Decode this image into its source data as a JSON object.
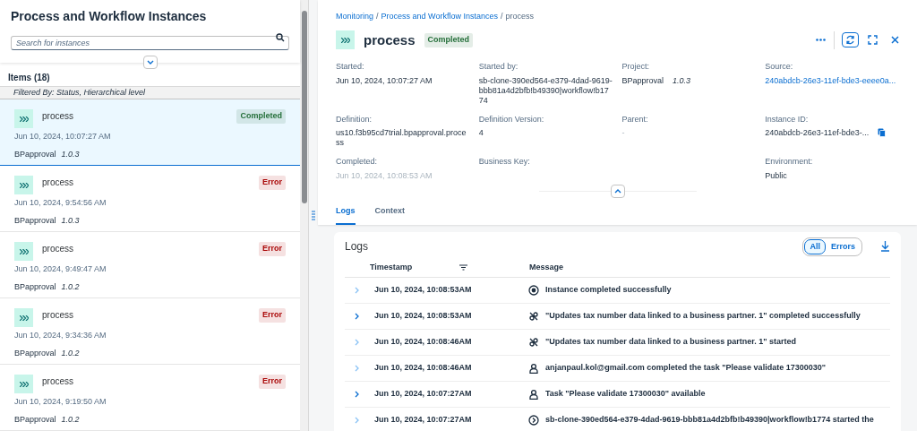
{
  "list_panel": {
    "title": "Process and Workflow Instances",
    "search": {
      "placeholder": "Search for instances"
    },
    "items_header": "Items (18)",
    "filter_info": "Filtered By: Status, Hierarchical level",
    "items": [
      {
        "name": "process",
        "status": "Completed",
        "color": "#256f3a",
        "time": "Jun 10, 2024, 10:07:27 AM",
        "project": "BPapproval",
        "version": "1.0.3",
        "selected": true
      },
      {
        "name": "process",
        "status": "Error",
        "color": "#aa0808",
        "time": "Jun 10, 2024, 9:54:56 AM",
        "project": "BPapproval",
        "version": "1.0.3",
        "selected": false
      },
      {
        "name": "process",
        "status": "Error",
        "color": "#aa0808",
        "time": "Jun 10, 2024, 9:49:47 AM",
        "project": "BPapproval",
        "version": "1.0.2",
        "selected": false
      },
      {
        "name": "process",
        "status": "Error",
        "color": "#aa0808",
        "time": "Jun 10, 2024, 9:34:36 AM",
        "project": "BPapproval",
        "version": "1.0.2",
        "selected": false
      },
      {
        "name": "process",
        "status": "Error",
        "color": "#aa0808",
        "time": "Jun 10, 2024, 9:19:50 AM",
        "project": "BPapproval",
        "version": "1.0.2",
        "selected": false
      }
    ]
  },
  "detail": {
    "breadcrumb": {
      "separator": "/",
      "items": [
        "Monitoring",
        "Process and Workflow Instances",
        "process"
      ]
    },
    "title": "process",
    "status": "Completed",
    "color": "#256f3a",
    "fields": [
      {
        "label": "Started:",
        "value": "Jun 10, 2024, 10:07:27 AM",
        "kind": "text"
      },
      {
        "label": "Started by:",
        "value": "sb-clone-390ed564-e379-4dad-9619-bbb81a4d2bfb!b49390|workflow!b1774",
        "kind": "text"
      },
      {
        "label": "Project:",
        "value": "BPapproval",
        "version": "1.0.3",
        "kind": "project"
      },
      {
        "label": "Source:",
        "value": "240abdcb-26e3-11ef-bde3-eeee0a...",
        "kind": "link"
      },
      {
        "label": "Definition:",
        "value": "us10.f3b95cd7trial.bpapproval.process",
        "kind": "text"
      },
      {
        "label": "Definition Version:",
        "value": "4",
        "kind": "text"
      },
      {
        "label": "Parent:",
        "value": "-",
        "kind": "muted"
      },
      {
        "label": "Instance ID:",
        "value": "240abdcb-26e3-11ef-bde3-...",
        "kind": "copy"
      },
      {
        "label": "Completed:",
        "value": "Jun 10, 2024, 10:08:53 AM",
        "kind": "muted"
      },
      {
        "label": "Business Key:",
        "kind": "text"
      },
      {
        "kind": "empty"
      },
      {
        "label": "Environment:",
        "value": "Public",
        "kind": "text"
      }
    ],
    "tabs": [
      {
        "label": "Logs",
        "selected": true
      },
      {
        "label": "Context",
        "selected": false
      }
    ],
    "logs": {
      "title": "Logs",
      "filters": [
        {
          "label": "All",
          "selected": true
        },
        {
          "label": "Errors",
          "selected": false
        }
      ],
      "columns": [
        "Timestamp",
        "Message"
      ],
      "rows": [
        {
          "timestamp": "Jun 10, 2024, 10:08:53AM",
          "message": "Instance completed successfully",
          "kind": "end",
          "emphasized": false
        },
        {
          "timestamp": "Jun 10, 2024, 10:08:53AM",
          "message": "\"Updates tax number data linked to a business partner. 1\" completed successfully",
          "kind": "service",
          "emphasized": true
        },
        {
          "timestamp": "Jun 10, 2024, 10:08:46AM",
          "message": "\"Updates tax number data linked to a business partner. 1\" started",
          "kind": "service",
          "emphasized": false
        },
        {
          "timestamp": "Jun 10, 2024, 10:08:46AM",
          "message": "anjanpaul.kol@gmail.com completed the task \"Please validate 17300030\"",
          "kind": "user",
          "emphasized": false
        },
        {
          "timestamp": "Jun 10, 2024, 10:07:27AM",
          "message": "Task \"Please validate 17300030\" available",
          "kind": "user",
          "emphasized": true
        },
        {
          "timestamp": "Jun 10, 2024, 10:07:27AM",
          "message": "sb-clone-390ed564-e379-4dad-9619-bbb81a4d2bfb!b49390|workflow!b1774 started the",
          "kind": "start",
          "emphasized": false
        }
      ]
    }
  }
}
